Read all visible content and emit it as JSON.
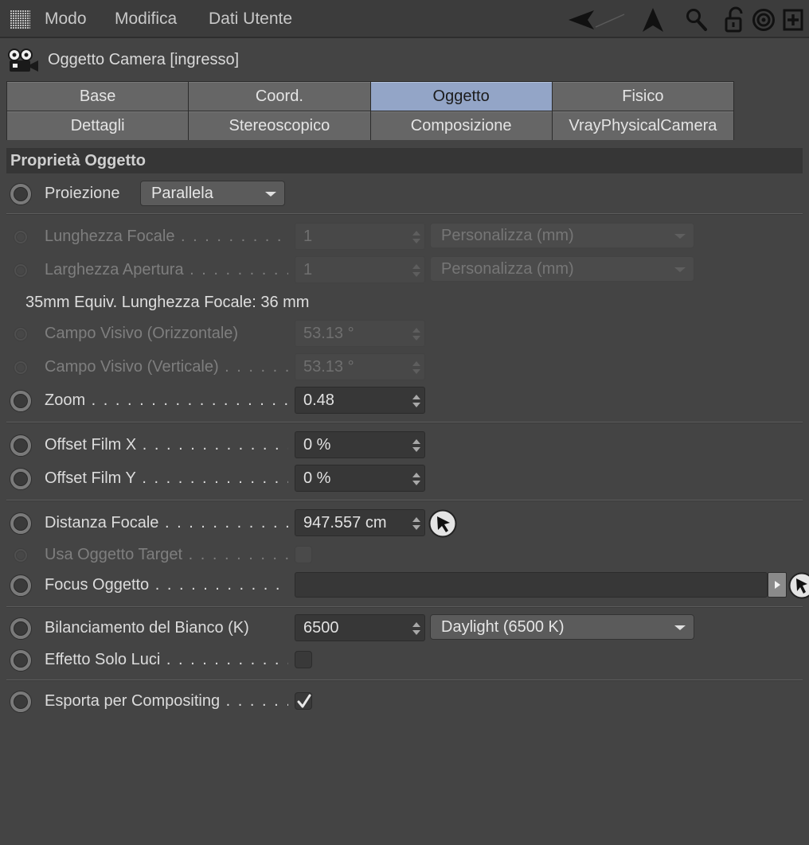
{
  "menu": {
    "items": [
      "Modo",
      "Modifica",
      "Dati Utente"
    ]
  },
  "toolbar_icons": [
    "back-arrow-icon",
    "up-arrow-icon",
    "search-icon",
    "lock-icon",
    "target-icon",
    "new-panel-icon"
  ],
  "header": {
    "icon": "camera-icon",
    "title": "Oggetto Camera [ingresso]"
  },
  "tabs": [
    {
      "label": "Base",
      "active": false
    },
    {
      "label": "Coord.",
      "active": false
    },
    {
      "label": "Oggetto",
      "active": true
    },
    {
      "label": "Fisico",
      "active": false
    },
    {
      "label": "Dettagli",
      "active": false
    },
    {
      "label": "Stereoscopico",
      "active": false
    },
    {
      "label": "Composizione",
      "active": false
    },
    {
      "label": "VrayPhysicalCamera",
      "active": false
    }
  ],
  "section": {
    "title": "Proprietà Oggetto"
  },
  "params": {
    "proiezione": {
      "label": "Proiezione",
      "value": "Parallela"
    },
    "lunghezza_focale": {
      "label": "Lunghezza Focale",
      "value": "1",
      "unit_dropdown": "Personalizza (mm)"
    },
    "larghezza_apertura": {
      "label": "Larghezza Apertura",
      "value": "1",
      "unit_dropdown": "Personalizza (mm)"
    },
    "equiv_info": "35mm Equiv. Lunghezza Focale: 36 mm",
    "campo_visivo_orizz": {
      "label": "Campo Visivo (Orizzontale)",
      "value": "53.13 °"
    },
    "campo_visivo_vert": {
      "label": "Campo Visivo (Verticale)",
      "value": "53.13 °"
    },
    "zoom": {
      "label": "Zoom",
      "value": "0.48"
    },
    "offset_film_x": {
      "label": "Offset Film X",
      "value": "0 %"
    },
    "offset_film_y": {
      "label": "Offset Film Y",
      "value": "0 %"
    },
    "distanza_focale": {
      "label": "Distanza Focale",
      "value": "947.557 cm"
    },
    "usa_oggetto_target": {
      "label": "Usa Oggetto Target",
      "checked": false
    },
    "focus_oggetto": {
      "label": "Focus Oggetto",
      "value": ""
    },
    "bilanciamento_bianco": {
      "label": "Bilanciamento del Bianco (K)",
      "value": "6500",
      "preset": "Daylight (6500 K)"
    },
    "effetto_solo_luci": {
      "label": "Effetto Solo Luci",
      "checked": false
    },
    "esporta_compositing": {
      "label": "Esporta per Compositing",
      "checked": true
    }
  },
  "colors": {
    "background": "#444444",
    "active_tab": "#93a5c7",
    "tab": "#666666",
    "field": "#373737"
  }
}
